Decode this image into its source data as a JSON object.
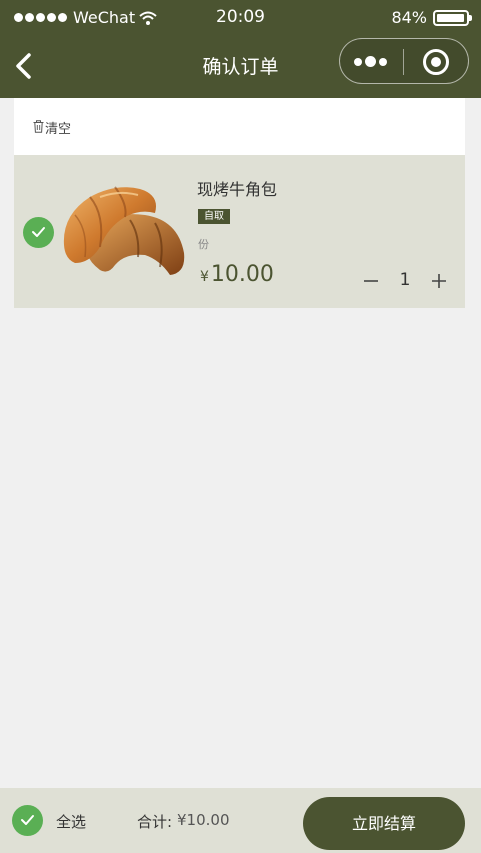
{
  "status_bar": {
    "carrier": "WeChat",
    "time": "20:09",
    "battery": "84%",
    "battery_level": 0.84
  },
  "nav": {
    "title": "确认订单",
    "icons": [
      "back-icon",
      "more-icon",
      "close-icon"
    ]
  },
  "cart": {
    "clear_label": "清空",
    "items": [
      {
        "name": "现烤牛角包",
        "tag": "自取",
        "unit": "份",
        "currency": "¥",
        "price": "10.00",
        "quantity": "1",
        "selected": true
      }
    ]
  },
  "footer": {
    "select_all_label": "全选",
    "total_label": "合计:",
    "total_value": "¥10.00",
    "checkout_label": "立即结算"
  },
  "colors": {
    "theme": "#4b5431",
    "check": "#5aaf54",
    "item_bg": "#dfe0d5",
    "page_bg": "#f0f0f0"
  }
}
